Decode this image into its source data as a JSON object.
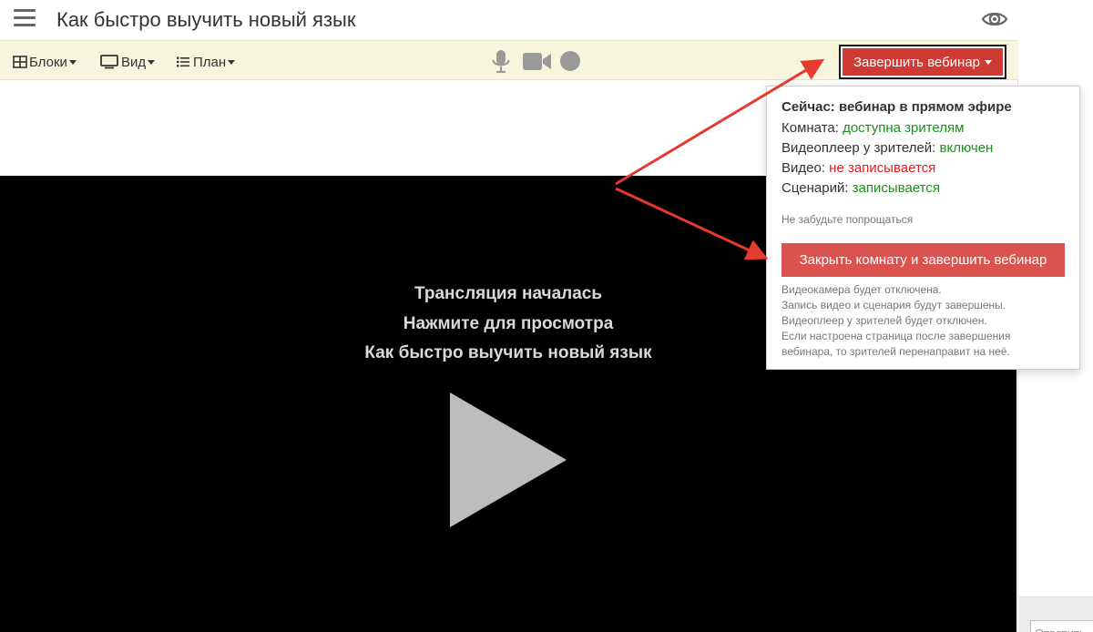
{
  "header": {
    "title": "Как быстро выучить новый язык"
  },
  "toolbar": {
    "blocks_label": "Блоки",
    "view_label": "Вид",
    "plan_label": "План",
    "end_webinar_label": "Завершить вебинар"
  },
  "video": {
    "line1": "Трансляция началась",
    "line2": "Нажмите для просмотра",
    "line3": "Как быстро выучить новый язык"
  },
  "dropdown": {
    "heading": "Сейчас: вебинар в прямом эфире",
    "room_label": "Комната:",
    "room_value": "доступна зрителям",
    "player_label": "Видеоплеер у зрителей:",
    "player_value": "включен",
    "video_label": "Видео:",
    "video_value": "не записывается",
    "script_label": "Сценарий:",
    "script_value": "записывается",
    "reminder": "Не забудьте попрощаться",
    "close_button": "Закрыть комнату и завершить вебинар",
    "info": [
      "Видеокамера будет отключена.",
      "Запись видео и сценария будут завершены.",
      "Видеоплеер у зрителей будет отключен.",
      "Если настроена страница после завершения",
      "вебинара, то зрителей перенаправит на неё."
    ]
  },
  "right_panel": {
    "reply_placeholder": "Ответить..."
  },
  "colors": {
    "toolbar_bg": "#f7f5dc",
    "end_button": "#d03a34",
    "close_button": "#db534e",
    "status_green": "#1d8f1d",
    "status_red": "#e21d1d",
    "annotation_arrow": "#e53a2f"
  },
  "icons": {
    "menu": "hamburger-menu-icon",
    "preview": "eye-icon",
    "blocks": "grid-icon",
    "view": "monitor-icon",
    "plan": "list-icon",
    "mic": "microphone-icon",
    "camera": "video-camera-icon",
    "record": "record-icon",
    "play": "play-icon"
  }
}
